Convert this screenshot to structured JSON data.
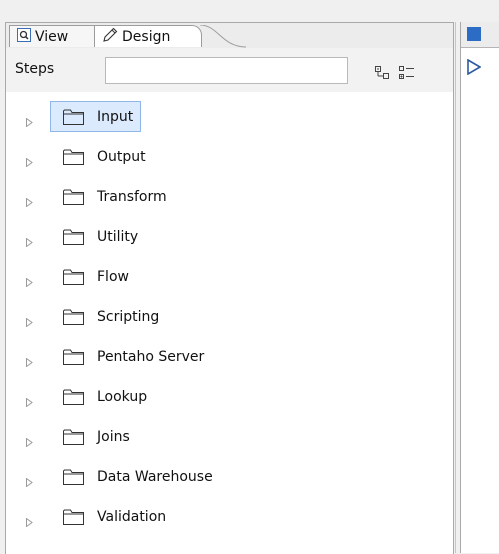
{
  "tabs": [
    {
      "label": "View",
      "icon": "view-icon"
    },
    {
      "label": "Design",
      "icon": "pencil-icon"
    }
  ],
  "steps": {
    "label": "Steps",
    "search_value": "",
    "collapse_icon": "tree-collapse-icon",
    "expand_icon": "list-expand-icon"
  },
  "tree": {
    "items": [
      {
        "label": "Input",
        "selected": true
      },
      {
        "label": "Output"
      },
      {
        "label": "Transform"
      },
      {
        "label": "Utility"
      },
      {
        "label": "Flow"
      },
      {
        "label": "Scripting"
      },
      {
        "label": "Pentaho Server"
      },
      {
        "label": "Lookup"
      },
      {
        "label": "Joins"
      },
      {
        "label": "Data Warehouse"
      },
      {
        "label": "Validation"
      }
    ]
  },
  "right_panel": {
    "tab_icon": "transformation-icon",
    "play_icon": "run-triangle-icon"
  },
  "colors": {
    "selection": "#dbeafd",
    "selection_border": "#8fb6e8",
    "accent": "#2d6cc5"
  }
}
